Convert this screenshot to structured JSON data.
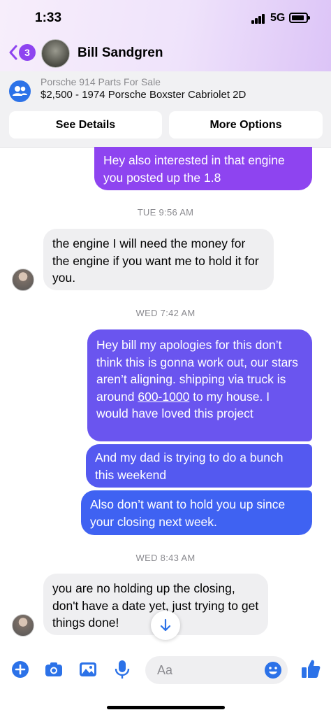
{
  "status": {
    "time": "1:33",
    "network": "5G"
  },
  "header": {
    "back_count": "3",
    "contact_name": "Bill Sandgren"
  },
  "listing": {
    "title": "Porsche 914 Parts For Sale",
    "subtitle": "$2,500 - 1974 Porsche Boxster Cabriolet 2D",
    "see_details": "See Details",
    "more_options": "More Options"
  },
  "messages": {
    "m1": "Hey also interested in that engine you posted up the 1.8",
    "ts1": "TUE 9:56 AM",
    "m2": "the engine I will need the money for the engine if you want me to hold it for you.",
    "ts2": "WED 7:42 AM",
    "m3_a": "Hey bill my apologies for this don’t think this is gonna work out, our stars aren’t aligning. shipping via truck is around ",
    "m3_link": "600-1000",
    "m3_b": " to my house. I would have loved this project",
    "m4": "And my dad is trying to do a bunch this weekend",
    "m5": "Also don’t want to hold you up since your closing next week.",
    "ts3": "WED 8:43 AM",
    "m6": "you are no holding up the closing, don't have a date yet, just trying to get things done!"
  },
  "composer": {
    "placeholder": "Aa"
  },
  "colors": {
    "accent": "#8e44f0",
    "messenger_blue": "#2c72e8",
    "bubble_purple": "#8e44f0",
    "bubble_blue": "#3f62f2"
  },
  "icons": [
    "back-chevron-icon",
    "group-icon",
    "scroll-down-arrow-icon",
    "plus-icon",
    "camera-icon",
    "image-icon",
    "microphone-icon",
    "emoji-icon",
    "thumbs-up-icon"
  ]
}
